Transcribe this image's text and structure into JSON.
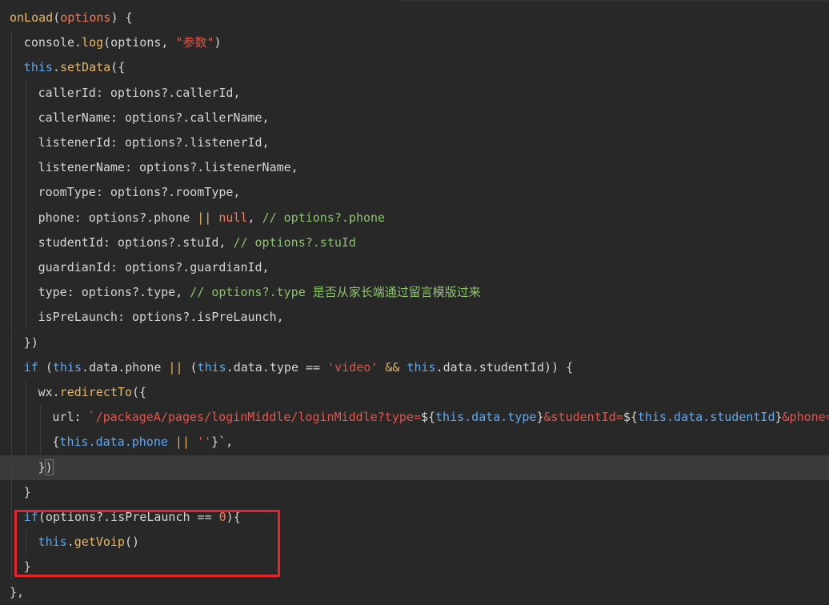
{
  "editor": {
    "lines": [
      {
        "indent": 0,
        "tokens": [
          [
            "onLoad",
            "func"
          ],
          [
            "(",
            "punct"
          ],
          [
            "options",
            "param"
          ],
          [
            ") {",
            "punct"
          ]
        ]
      },
      {
        "indent": 1,
        "tokens": [
          [
            "console",
            "plain"
          ],
          [
            ".",
            "punct"
          ],
          [
            "log",
            "func"
          ],
          [
            "(options, ",
            "punct"
          ],
          [
            "\"参数\"",
            "string"
          ],
          [
            ")",
            "punct"
          ]
        ]
      },
      {
        "indent": 1,
        "tokens": [
          [
            "this",
            "keyword"
          ],
          [
            ".",
            "punct"
          ],
          [
            "setData",
            "func"
          ],
          [
            "({",
            "punct"
          ]
        ]
      },
      {
        "indent": 2,
        "tokens": [
          [
            "callerId",
            "prop"
          ],
          [
            ": options?.callerId,",
            "plain"
          ]
        ]
      },
      {
        "indent": 2,
        "tokens": [
          [
            "callerName",
            "prop"
          ],
          [
            ": options?.callerName,",
            "plain"
          ]
        ]
      },
      {
        "indent": 2,
        "tokens": [
          [
            "listenerId",
            "prop"
          ],
          [
            ": options?.listenerId,",
            "plain"
          ]
        ]
      },
      {
        "indent": 2,
        "tokens": [
          [
            "listenerName",
            "prop"
          ],
          [
            ": options?.listenerName,",
            "plain"
          ]
        ]
      },
      {
        "indent": 2,
        "tokens": [
          [
            "roomType",
            "prop"
          ],
          [
            ": options?.roomType,",
            "plain"
          ]
        ]
      },
      {
        "indent": 2,
        "tokens": [
          [
            "phone",
            "prop"
          ],
          [
            ": options?.phone ",
            "plain"
          ],
          [
            "||",
            "op"
          ],
          [
            " ",
            "plain"
          ],
          [
            "null",
            "null"
          ],
          [
            ", ",
            "plain"
          ],
          [
            "// options?.phone",
            "comment"
          ]
        ]
      },
      {
        "indent": 2,
        "tokens": [
          [
            "studentId",
            "prop"
          ],
          [
            ": options?.stuId, ",
            "plain"
          ],
          [
            "// options?.stuId",
            "comment"
          ]
        ]
      },
      {
        "indent": 2,
        "tokens": [
          [
            "guardianId",
            "prop"
          ],
          [
            ": options?.guardianId,",
            "plain"
          ]
        ]
      },
      {
        "indent": 2,
        "tokens": [
          [
            "type",
            "prop"
          ],
          [
            ": options?.type, ",
            "plain"
          ],
          [
            "// options?.type 是否从家长端通过留言模版过来",
            "comment"
          ]
        ]
      },
      {
        "indent": 2,
        "tokens": [
          [
            "isPreLaunch",
            "prop"
          ],
          [
            ": options?.isPreLaunch,",
            "plain"
          ]
        ]
      },
      {
        "indent": 1,
        "tokens": [
          [
            "})",
            "punct"
          ]
        ]
      },
      {
        "indent": 1,
        "tokens": [
          [
            "if",
            "keyword"
          ],
          [
            " (",
            "punct"
          ],
          [
            "this",
            "keyword"
          ],
          [
            ".data.phone ",
            "plain"
          ],
          [
            "||",
            "op"
          ],
          [
            " (",
            "punct"
          ],
          [
            "this",
            "keyword"
          ],
          [
            ".data.type == ",
            "plain"
          ],
          [
            "'video'",
            "string"
          ],
          [
            " ",
            "plain"
          ],
          [
            "&&",
            "op"
          ],
          [
            " ",
            "plain"
          ],
          [
            "this",
            "keyword"
          ],
          [
            ".data.studentId)) {",
            "plain"
          ]
        ]
      },
      {
        "indent": 2,
        "tokens": [
          [
            "wx",
            "plain"
          ],
          [
            ".",
            "punct"
          ],
          [
            "redirectTo",
            "func"
          ],
          [
            "({",
            "punct"
          ]
        ]
      },
      {
        "indent": 3,
        "tokens": [
          [
            "url",
            "prop"
          ],
          [
            ": ",
            "plain"
          ],
          [
            "`/packageA/pages/loginMiddle/loginMiddle?type=",
            "string"
          ],
          [
            "${",
            "plain"
          ],
          [
            "this",
            "keyword"
          ],
          [
            ".data.type",
            "template"
          ],
          [
            "}",
            "plain"
          ],
          [
            "&studentId=",
            "string"
          ],
          [
            "${",
            "plain"
          ],
          [
            "this",
            "keyword"
          ],
          [
            ".data.studentId",
            "template"
          ],
          [
            "}",
            "plain"
          ],
          [
            "&phone=$",
            "string"
          ]
        ]
      },
      {
        "indent": 3,
        "tokens": [
          [
            "{",
            "plain"
          ],
          [
            "this",
            "keyword"
          ],
          [
            ".data.phone ",
            "template"
          ],
          [
            "||",
            "op"
          ],
          [
            " ",
            "plain"
          ],
          [
            "''",
            "string"
          ],
          [
            "}`",
            "plain"
          ],
          [
            ",",
            "punct"
          ]
        ]
      },
      {
        "indent": 2,
        "active": true,
        "tokens": [
          [
            "}",
            "punct"
          ],
          [
            ")",
            "bracket-match"
          ]
        ]
      },
      {
        "indent": 1,
        "tokens": [
          [
            "}",
            "punct"
          ]
        ]
      },
      {
        "indent": 1,
        "tokens": [
          [
            "if",
            "keyword"
          ],
          [
            "(options?.isPreLaunch == ",
            "plain"
          ],
          [
            "0",
            "number"
          ],
          [
            "){",
            "punct"
          ]
        ]
      },
      {
        "indent": 2,
        "tokens": [
          [
            "this",
            "keyword"
          ],
          [
            ".",
            "punct"
          ],
          [
            "getVoip",
            "func"
          ],
          [
            "()",
            "punct"
          ]
        ]
      },
      {
        "indent": 1,
        "tokens": [
          [
            "}",
            "punct"
          ]
        ]
      },
      {
        "indent": 0,
        "tokens": [
          [
            "},",
            "punct"
          ]
        ]
      }
    ]
  }
}
